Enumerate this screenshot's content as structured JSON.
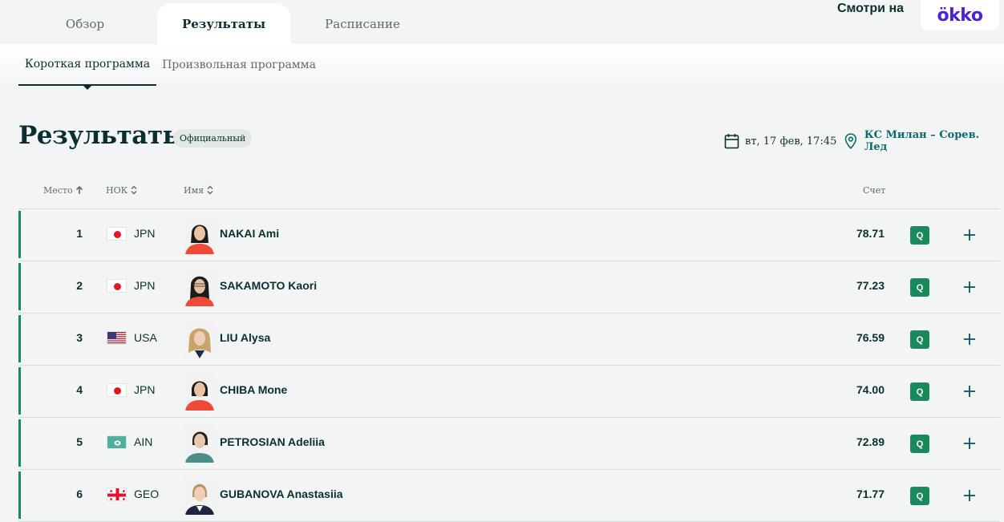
{
  "tabs": [
    "Обзор",
    "Результаты",
    "Расписание"
  ],
  "watch": {
    "label": "Смотри на",
    "brand": "ökko"
  },
  "subtabs": [
    "Короткая программа",
    "Произвольная программа"
  ],
  "heading": {
    "title": "Результаты",
    "status": "Официальный",
    "date": "вт, 17 фев, 17:45",
    "venue": "КС Милан – Сорев. Лед"
  },
  "table": {
    "headers": {
      "place": "Место",
      "noc": "НОК",
      "name": "Имя",
      "score": "Счет"
    },
    "rows": [
      {
        "rank": "1",
        "noc": "JPN",
        "flag": "jpn-flag-icon",
        "name": "NAKAI Ami",
        "score": "78.71",
        "badge": "Q"
      },
      {
        "rank": "2",
        "noc": "JPN",
        "flag": "jpn-flag-icon",
        "name": "SAKAMOTO Kaori",
        "score": "77.23",
        "badge": "Q"
      },
      {
        "rank": "3",
        "noc": "USA",
        "flag": "usa-flag-icon",
        "name": "LIU Alysa",
        "score": "76.59",
        "badge": "Q"
      },
      {
        "rank": "4",
        "noc": "JPN",
        "flag": "jpn-flag-icon",
        "name": "CHIBA Mone",
        "score": "74.00",
        "badge": "Q"
      },
      {
        "rank": "5",
        "noc": "AIN",
        "flag": "ain-flag-icon",
        "name": "PETROSIAN Adeliia",
        "score": "72.89",
        "badge": "Q"
      },
      {
        "rank": "6",
        "noc": "GEO",
        "flag": "geo-flag-icon",
        "name": "GUBANOVA Anastasiia",
        "score": "71.77",
        "badge": "Q"
      }
    ]
  },
  "colors": {
    "accent_green": "#1a8a5c",
    "text_dark": "#0b2e33",
    "venue_teal": "#0a6a6e",
    "okko_purple": "#4b22d4"
  }
}
